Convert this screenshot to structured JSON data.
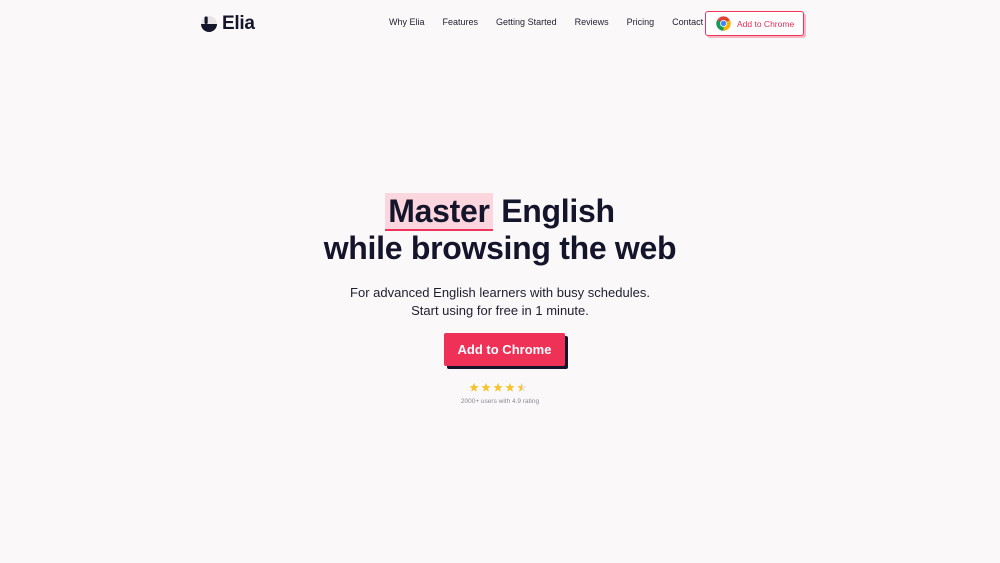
{
  "brand": {
    "name": "Elia"
  },
  "nav": {
    "items": [
      "Why Elia",
      "Features",
      "Getting Started",
      "Reviews",
      "Pricing",
      "Contact"
    ],
    "cta_label": "Add to Chrome"
  },
  "hero": {
    "highlight_word": "Master",
    "title_rest_line1": " English",
    "title_line2": "while browsing the web",
    "subtitle_line1": "For advanced English learners with busy schedules.",
    "subtitle_line2": "Start using for free in 1 minute.",
    "cta_label": "Add to Chrome",
    "rating": 4.9,
    "stars_shown": 4.5,
    "rating_text": "2000+ users with 4.9 rating"
  },
  "colors": {
    "background": "#fbf8f9",
    "accent": "#ef3157",
    "highlight": "#fbd6de",
    "text": "#14142b",
    "star": "#f5c430"
  },
  "icons": [
    "elia-logo-icon",
    "chrome-icon",
    "star-icon"
  ]
}
